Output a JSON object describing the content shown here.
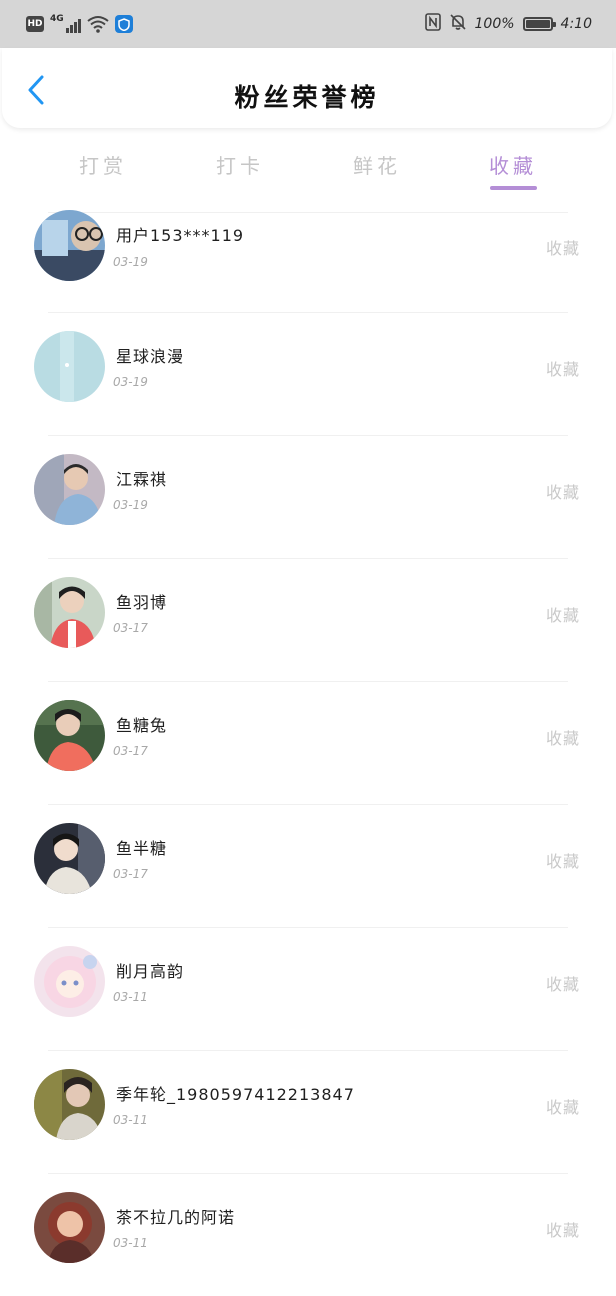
{
  "status_bar": {
    "hd": "HD",
    "network": "4G",
    "battery_pct": "100%",
    "battery_level": 1.0,
    "time": "4:10"
  },
  "header": {
    "title": "粉丝荣誉榜",
    "back_icon": "chevron-left-icon"
  },
  "tabs": [
    {
      "label": "打赏",
      "active": false
    },
    {
      "label": "打卡",
      "active": false
    },
    {
      "label": "鲜花",
      "active": false
    },
    {
      "label": "收藏",
      "active": true
    }
  ],
  "accent_color": "#b48ed6",
  "back_color": "#2196f3",
  "list": [
    {
      "name": "用户153***119",
      "date": "03-19",
      "action": "收藏"
    },
    {
      "name": "星球浪漫",
      "date": "03-19",
      "action": "收藏"
    },
    {
      "name": "江霖祺",
      "date": "03-19",
      "action": "收藏"
    },
    {
      "name": "鱼羽博",
      "date": "03-17",
      "action": "收藏"
    },
    {
      "name": "鱼糖兔",
      "date": "03-17",
      "action": "收藏"
    },
    {
      "name": "鱼半糖",
      "date": "03-17",
      "action": "收藏"
    },
    {
      "name": "削月高韵",
      "date": "03-11",
      "action": "收藏"
    },
    {
      "name": "季年轮_1980597412213847",
      "date": "03-11",
      "action": "收藏"
    },
    {
      "name": "茶不拉几的阿诺",
      "date": "03-11",
      "action": "收藏"
    }
  ]
}
